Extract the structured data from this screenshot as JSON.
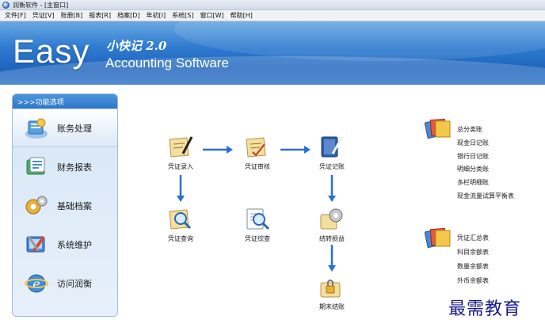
{
  "window": {
    "title": "润衡软件 - [主窗口]"
  },
  "menu": [
    "文件[F]",
    "凭证[V]",
    "账册[B]",
    "报表[R]",
    "档案[D]",
    "年初[I]",
    "系统[S]",
    "窗口[W]",
    "帮助[H]"
  ],
  "banner": {
    "logo": "Easy",
    "product_cn": "小快记 2.0",
    "subtitle": "Accounting Software"
  },
  "sidebar": {
    "header": ">>>功能选项",
    "items": [
      {
        "label": "账务处理",
        "icon": "ledger-icon",
        "active": true
      },
      {
        "label": "财务报表",
        "icon": "report-icon",
        "active": false
      },
      {
        "label": "基础档案",
        "icon": "gears-icon",
        "active": false
      },
      {
        "label": "系统维护",
        "icon": "tools-icon",
        "active": false
      },
      {
        "label": "访问润衡",
        "icon": "ie-globe-icon",
        "active": false
      }
    ]
  },
  "workflow": {
    "entry": "凭证录入",
    "audit": "凭证审核",
    "post": "凭证记账",
    "query": "凭证查询",
    "summary": "凭证综查",
    "transfer": "结转损益",
    "close": "期末结账"
  },
  "ledger_links": {
    "icon": "books-icon",
    "items": [
      "总分类账",
      "现金日记账",
      "银行日记账",
      "明细分类账",
      "多栏明细账",
      "现金流量试算平衡表"
    ]
  },
  "summary_links": {
    "icon": "books-icon",
    "items": [
      "凭证汇总表",
      "科目余额表",
      "数量余额表",
      "外币余额表"
    ]
  },
  "watermark": "最需教育",
  "colors": {
    "banner": "#2f7bd0",
    "arrow": "#2a6fd8",
    "sidebar_header": "#3a82d0"
  }
}
